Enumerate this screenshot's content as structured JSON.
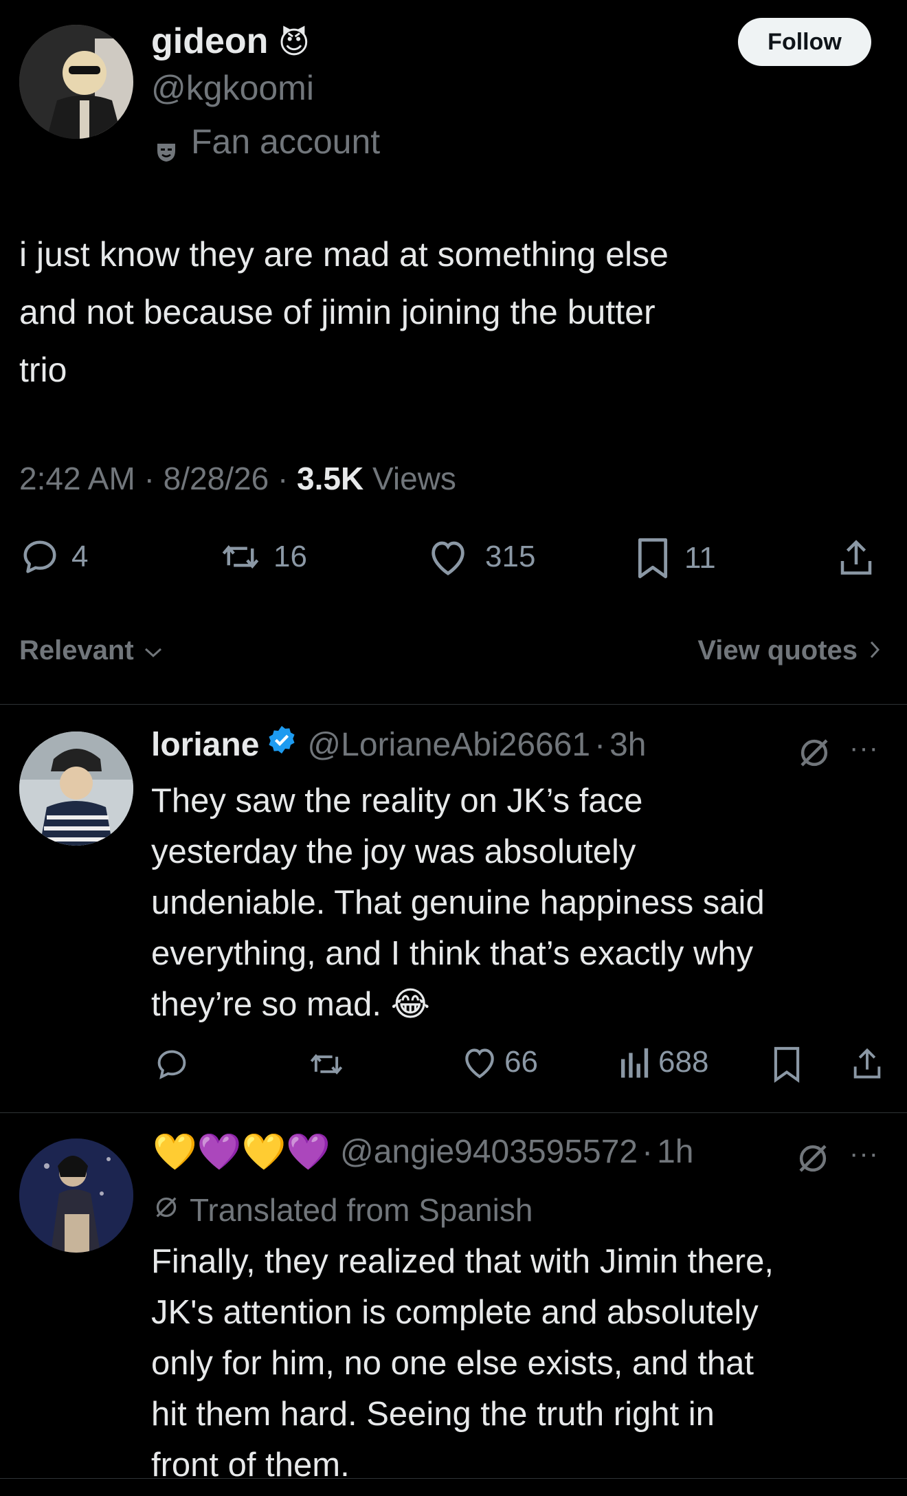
{
  "main_post": {
    "display_name": "gideon",
    "name_emoji": "😈",
    "handle": "@kgkoomi",
    "account_label": "Fan account",
    "follow_label": "Follow",
    "text_lines": [
      "i just know they are mad at something else",
      "and not because of jimin joining the butter",
      "trio"
    ],
    "time": "2:42 AM",
    "date": "8/28/26",
    "views_count": "3.5K",
    "views_label": "Views",
    "sep1": "·",
    "sep2": "·",
    "actions": {
      "replies": "4",
      "reposts": "16",
      "likes": "315",
      "bookmarks": "11"
    }
  },
  "sort": {
    "label": "Relevant",
    "view_quotes": "View quotes"
  },
  "replies": [
    {
      "display_name": "loriane",
      "handle": "@LorianeAbi26661",
      "sep": "·",
      "time": "3h",
      "text_lines": [
        "They saw the reality on JK’s face",
        "yesterday the joy was absolutely",
        "undeniable. That genuine happiness said",
        "everything, and I think that’s exactly why",
        "they’re so mad. 😂"
      ],
      "likes": "66",
      "views": "688"
    },
    {
      "display_name": "💛💜💛💜",
      "handle": "@angie9403595572",
      "sep": "·",
      "time": "1h",
      "translated_label": "Translated from Spanish",
      "text_lines": [
        "Finally, they realized that with Jimin there,",
        "JK's attention is complete and absolutely",
        "only for him, no one else exists, and that",
        "hit them hard. Seeing the truth right in",
        "front of them."
      ]
    }
  ],
  "colors": {
    "background": "#000000",
    "text": "#e7e9ea",
    "muted": "#71767b",
    "verified": "#1d9bf0",
    "divider": "#2f3336"
  }
}
